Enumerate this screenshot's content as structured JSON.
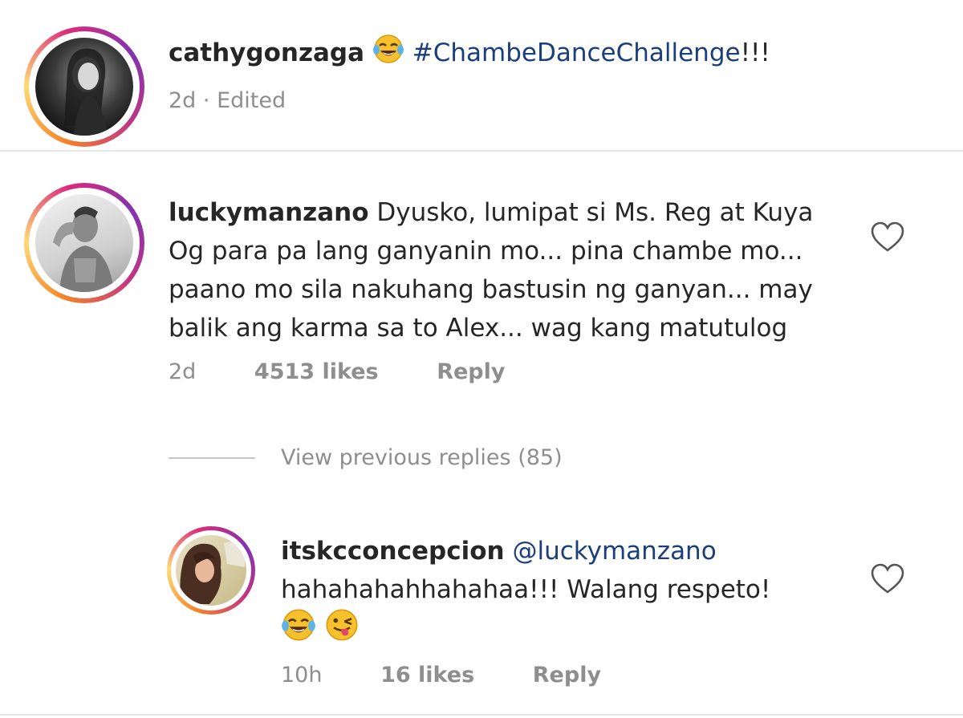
{
  "caption": {
    "username": "cathygonzaga",
    "emoji": "face-with-tears-of-joy",
    "hashtag": "#ChambeDanceChallenge",
    "suffix": "!!!",
    "meta": "2d · Edited"
  },
  "comment": {
    "username": "luckymanzano",
    "lines": [
      "Dyusko, lumipat si Ms. Reg at Kuya",
      "Og para pa lang ganyanin mo... pina chambe mo...",
      "paano mo sila nakuhang bastusin ng ganyan... may",
      "balik ang karma sa to Alex... wag kang matutulog"
    ],
    "time": "2d",
    "likes": "4513 likes",
    "reply_label": "Reply"
  },
  "view_replies": {
    "label": "View previous replies (85)"
  },
  "reply": {
    "username": "itskcconcepcion",
    "mention": "@luckymanzano",
    "line2": "hahahahahhahahaa!!! Walang respeto!",
    "emojis": [
      "face-with-tears-of-joy",
      "winking-face-with-tongue"
    ],
    "time": "10h",
    "likes": "16 likes",
    "reply_label": "Reply"
  },
  "colors": {
    "hashtag": "#1a3f7a",
    "meta_gray": "#8e8e8e",
    "text": "#262626"
  }
}
